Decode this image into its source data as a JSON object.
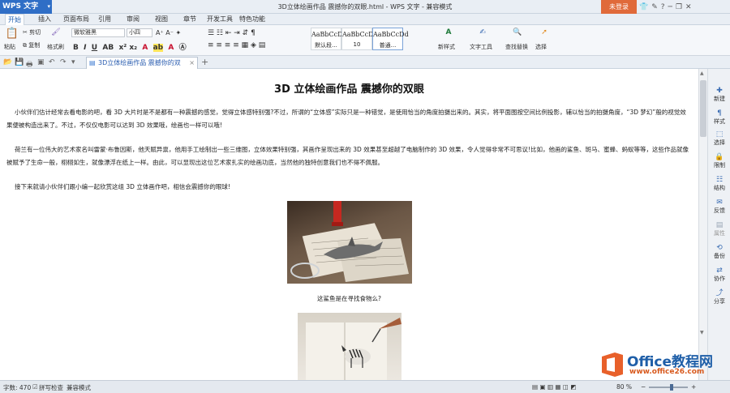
{
  "app": {
    "menu_label": "WPS 文字",
    "window_title": "3D立体绘画作品 震撼你的双眼.html - WPS 文字 - 兼容模式",
    "login_label": "未登录"
  },
  "tabs": [
    "开始",
    "插入",
    "页面布局",
    "引用",
    "审阅",
    "视图",
    "章节",
    "开发工具",
    "特色功能"
  ],
  "ribbon": {
    "paste": "粘贴",
    "cut": "剪切",
    "copy": "复制",
    "format_painter": "格式刷",
    "font_name": "微软雅黑",
    "font_size": "小四",
    "styles": [
      {
        "preview": "AaBbCcDd",
        "name": "默认段..."
      },
      {
        "preview": "AaBbCcDd",
        "name": "10"
      },
      {
        "preview": "AaBbCcDd",
        "name": "普通..."
      }
    ],
    "new_style": "新样式",
    "text_tools": "文字工具",
    "find_replace": "查找替换",
    "select": "选择"
  },
  "doc_tab": {
    "name": "3D立体绘画作品 震撼你的双眼.html"
  },
  "document": {
    "heading": "3D 立体绘画作品 震撼你的双眼",
    "para1": "小伙伴们估计经常去看电影的吧，看 3D 大片时是不是都有一种震撼的感觉，觉得立体感特别强?不过，所谓的“立体感”实际只是一种错觉，是使用恰当的角度拍摄出来的。其实，将平面图按空间比例投影，辅以恰当的拍摄角度，“3D 梦幻”般的视觉效果便被构造出来了。不过，不仅仅电影可以达到 3D 效果哦，绘画也一样可以哦!",
    "para2": "荷兰有一位伟大的艺术家名叫雷蒙·布鲁因斯，他天赋异禀，他用手工绘制出一些三维图，立体效果特别强，其画作呈现出来的 3D 效果甚至超越了电脑制作的 3D 效果，令人觉得非常不可思议!比如，他画的鲨鱼、斑马、蜜蜂、蚂蚁等等，这些作品就像被赋予了生命一般，栩栩如生，就像漂浮在纸上一样。由此，可以显现出这位艺术家扎实的绘画功底，当然他的独特创意我们也不得不佩服。",
    "para3": "接下来就请小伙伴们跟小编一起欣赏这组 3D 立体画作吧，相信会震撼你的眼球!",
    "caption1": "这鲨鱼是在寻找食物么?"
  },
  "side_panel": [
    "新建",
    "样式",
    "选择",
    "限制",
    "结构",
    "反馈",
    "属性",
    "备份",
    "协作",
    "分享"
  ],
  "status": {
    "word_count": "字数: 470",
    "spell_check": "拼写检查",
    "compat_mode": "兼容模式",
    "zoom": "80 %"
  },
  "watermark": {
    "brand": "Office教程网",
    "url": "www.office26.com"
  },
  "colors": {
    "accent": "#2f6ec6",
    "login": "#e06a3a",
    "watermark_orange": "#d85a1e"
  }
}
